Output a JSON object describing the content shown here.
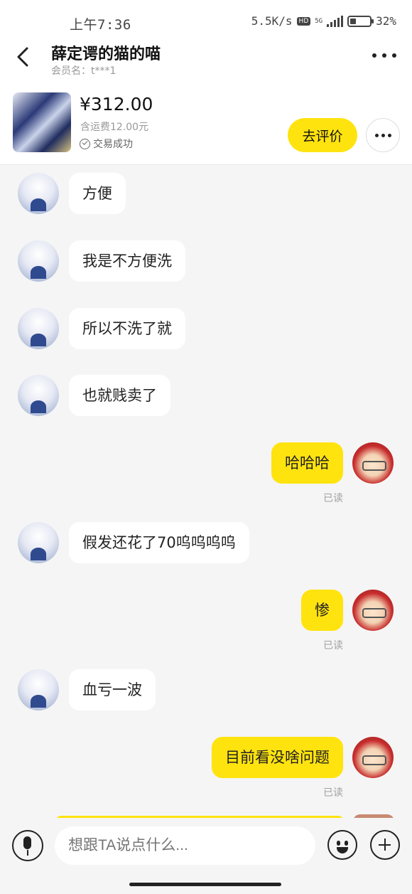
{
  "status_bar": {
    "time": "上午7:36",
    "network_speed": "5.5K/s",
    "hd_badge": "HD",
    "network_type": "5G",
    "battery": "32%",
    "battery_level": 0.32
  },
  "header": {
    "title": "薛定谔的猫的喵",
    "member_label": "会员名：t***1",
    "back_icon": "chevron-left-icon",
    "more_icon": "more-horizontal-icon"
  },
  "product": {
    "price": "¥312.00",
    "shipping": "含运费12.00元",
    "status": "交易成功",
    "review_button": "去评价",
    "more_icon": "more-horizontal-icon"
  },
  "messages": [
    {
      "side": "left",
      "text": "方便"
    },
    {
      "side": "left",
      "text": "我是不方便洗"
    },
    {
      "side": "left",
      "text": "所以不洗了就"
    },
    {
      "side": "left",
      "text": "也就贱卖了"
    },
    {
      "side": "right",
      "text": "哈哈哈",
      "status": "已读"
    },
    {
      "side": "left",
      "text": "假发还花了70呜呜呜呜"
    },
    {
      "side": "right",
      "text": "惨",
      "status": "已读"
    },
    {
      "side": "left",
      "text": "血亏一波"
    },
    {
      "side": "right",
      "text": "目前看没啥问题",
      "status": "已读"
    }
  ],
  "input_bar": {
    "placeholder": "想跟TA说点什么...",
    "mic_icon": "microphone-icon",
    "emoji_icon": "emoji-icon",
    "add_icon": "plus-icon"
  },
  "colors": {
    "accent_yellow": "#ffe30f",
    "background": "#f5f5f5"
  }
}
